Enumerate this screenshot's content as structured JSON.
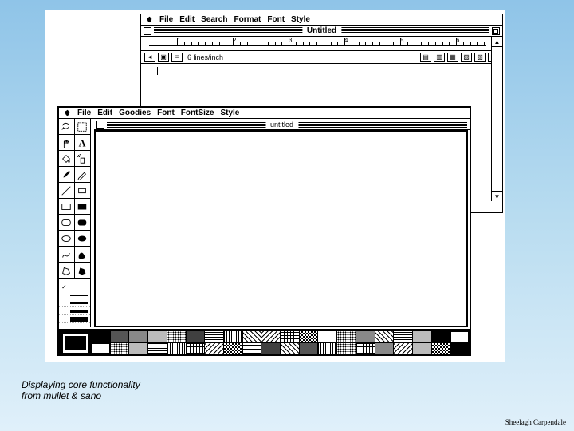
{
  "slide": {
    "caption_line1": "Displaying core functionality",
    "caption_line2": "from mullet & sano",
    "attribution": "Sheelagh Carpendale"
  },
  "back_window": {
    "menubar": [
      "File",
      "Edit",
      "Search",
      "Format",
      "Font",
      "Style"
    ],
    "title": "Untitled",
    "ruler_numbers": [
      "1",
      "2",
      "3",
      "4",
      "5",
      "6"
    ],
    "toolbar_label": "6 lines/inch"
  },
  "front_window": {
    "menubar": [
      "File",
      "Edit",
      "Goodies",
      "Font",
      "FontSize",
      "Style"
    ],
    "title": "untitled",
    "tools": [
      "lasso-icon",
      "select-icon",
      "hand-icon",
      "text-icon",
      "bucket-icon",
      "spray-icon",
      "brush-icon",
      "pencil-icon",
      "line-icon",
      "eraser-icon",
      "rect-icon",
      "fillrect-icon",
      "roundrect-icon",
      "fillroundrect-icon",
      "oval-icon",
      "filloval-icon",
      "freeform-icon",
      "fillfreeform-icon",
      "polygon-icon",
      "fillpolygon-icon"
    ],
    "linewidths": [
      1,
      2,
      3,
      4,
      6
    ],
    "selected_linewidth": 0,
    "patterns": [
      "p-black",
      "p-gray3",
      "p-gray",
      "p-gray2",
      "p-dots",
      "p-dense",
      "p-hlines",
      "p-vlines",
      "p-diag1",
      "p-diag2",
      "p-cross",
      "p-check",
      "p-brick",
      "p-dots",
      "p-gray",
      "p-diag1",
      "p-hlines",
      "p-gray2",
      "p-black",
      "p-white",
      "p-white",
      "p-dots",
      "p-gray2",
      "p-hlines",
      "p-vlines",
      "p-cross",
      "p-diag2",
      "p-check",
      "p-brick",
      "p-dense",
      "p-diag1",
      "p-gray3",
      "p-vlines",
      "p-dots",
      "p-cross",
      "p-gray",
      "p-diag2",
      "p-gray2",
      "p-check",
      "p-black"
    ]
  }
}
